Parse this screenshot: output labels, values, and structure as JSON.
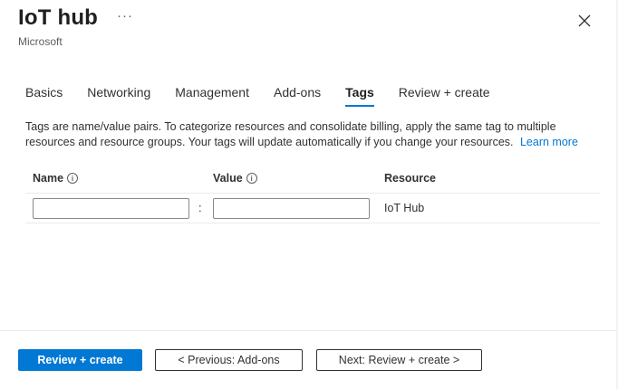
{
  "header": {
    "title": "IoT hub",
    "subtitle": "Microsoft",
    "more_label": "···"
  },
  "tabs": [
    {
      "label": "Basics",
      "active": false
    },
    {
      "label": "Networking",
      "active": false
    },
    {
      "label": "Management",
      "active": false
    },
    {
      "label": "Add-ons",
      "active": false
    },
    {
      "label": "Tags",
      "active": true
    },
    {
      "label": "Review + create",
      "active": false
    }
  ],
  "description": {
    "text": "Tags are name/value pairs. To categorize resources and consolidate billing, apply the same tag to multiple resources and resource groups. Your tags will update automatically if you change your resources.",
    "link_label": "Learn more"
  },
  "grid": {
    "columns": {
      "name": "Name",
      "value": "Value",
      "resource": "Resource"
    },
    "info_glyph": "i",
    "separator": ":",
    "row": {
      "name_value": "",
      "value_value": "",
      "resource": "IoT Hub"
    }
  },
  "footer": {
    "review_create": "Review + create",
    "previous": "< Previous: Add-ons",
    "next": "Next: Review + create >"
  },
  "colors": {
    "accent": "#0078d4",
    "text": "#323130",
    "divider": "#edebe9"
  },
  "icons": {
    "close": "close-icon",
    "more": "more-icon",
    "info": "info-icon"
  }
}
